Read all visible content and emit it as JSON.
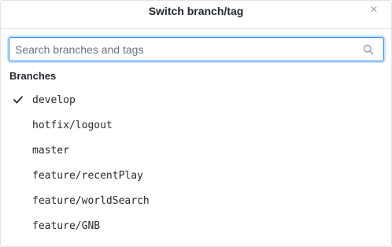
{
  "dialog": {
    "title": "Switch branch/tag",
    "close_glyph": "×"
  },
  "search": {
    "placeholder": "Search branches and tags",
    "value": "",
    "icon": "search-icon"
  },
  "branches": {
    "section_label": "Branches",
    "items": [
      {
        "label": "develop",
        "selected": true
      },
      {
        "label": "hotfix/logout",
        "selected": false
      },
      {
        "label": "master",
        "selected": false
      },
      {
        "label": "feature/recentPlay",
        "selected": false
      },
      {
        "label": "feature/worldSearch",
        "selected": false
      },
      {
        "label": "feature/GNB",
        "selected": false
      }
    ]
  },
  "colors": {
    "focus_border": "#2188ff",
    "text": "#24292e",
    "muted": "#959da5"
  }
}
